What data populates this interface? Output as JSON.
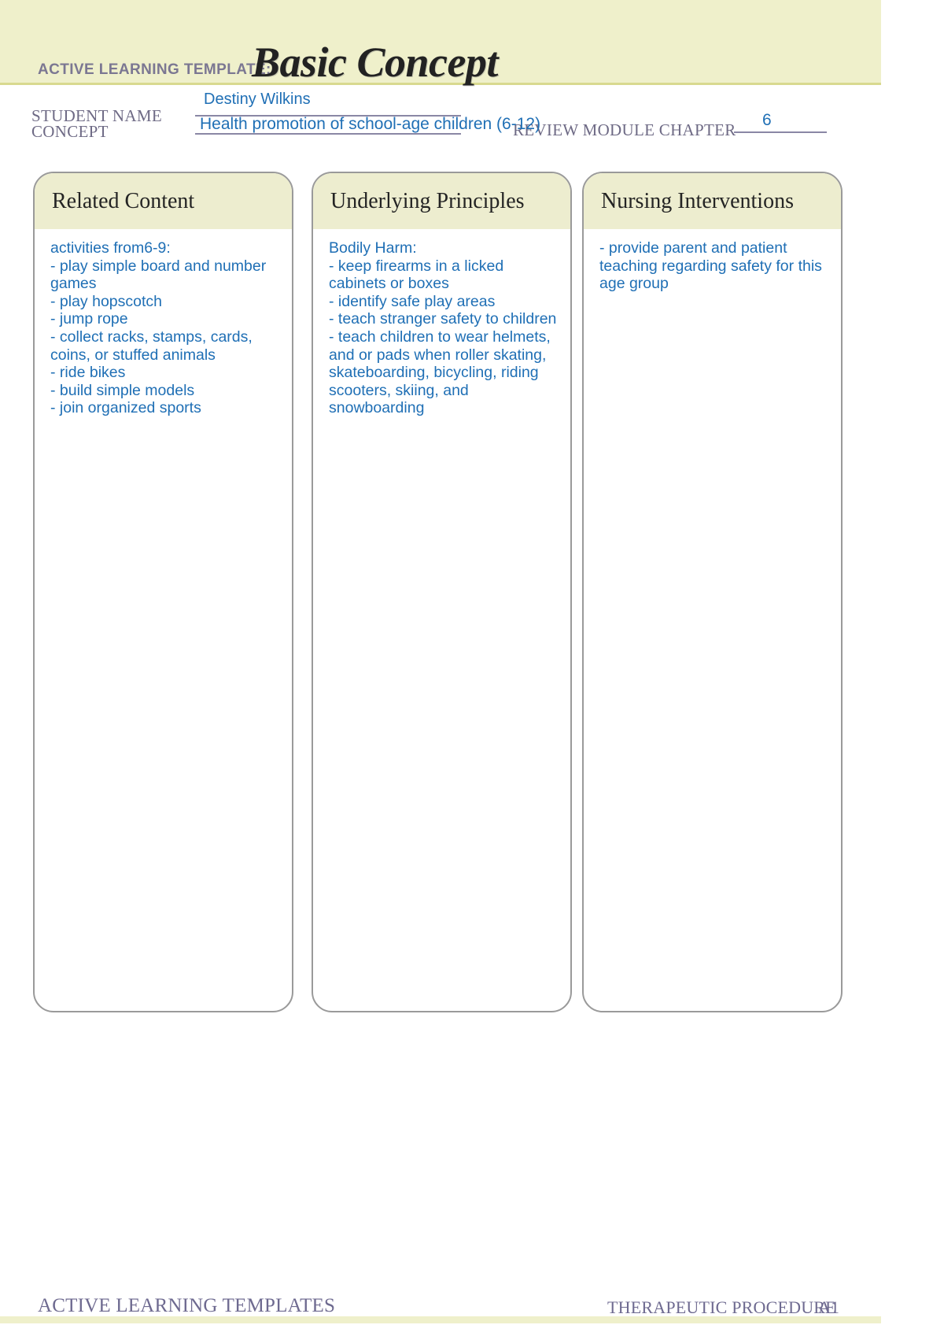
{
  "header": {
    "template_label": "ACTIVE LEARNING TEMPLATE:",
    "template_title": "Basic Concept",
    "band_color": "#eff0cb",
    "accent_color": "#d8d98f"
  },
  "fields": {
    "student_name_label": "STUDENT NAME",
    "student_name_value": "Destiny Wilkins",
    "concept_label": "CONCEPT",
    "concept_value": "Health promotion of school-age children (6-12)",
    "review_module_label": "REVIEW MODULE CHAPTER",
    "review_module_value": "6",
    "handwriting_color": "#1f6fb5",
    "rule_color": "#8a87a5"
  },
  "columns": [
    {
      "heading": "Related Content",
      "body": "activities from6-9:\n- play simple board and number games\n- play hopscotch\n- jump rope\n- collect racks, stamps, cards, coins, or stuffed animals\n- ride bikes\n- build simple models\n- join organized sports"
    },
    {
      "heading": "Underlying Principles",
      "body": "Bodily Harm:\n- keep firearms in a licked cabinets or boxes\n- identify safe play areas\n- teach stranger safety to children\n- teach children to wear helmets, and or pads when roller skating, skateboarding, bicycling, riding scooters, skiing, and snowboarding"
    },
    {
      "heading": "Nursing Interventions",
      "body": "- provide parent and patient teaching regarding safety for this age group"
    }
  ],
  "footer": {
    "left": "ACTIVE LEARNING TEMPLATES",
    "right": "THERAPEUTIC PROCEDURE",
    "code": "A1"
  }
}
